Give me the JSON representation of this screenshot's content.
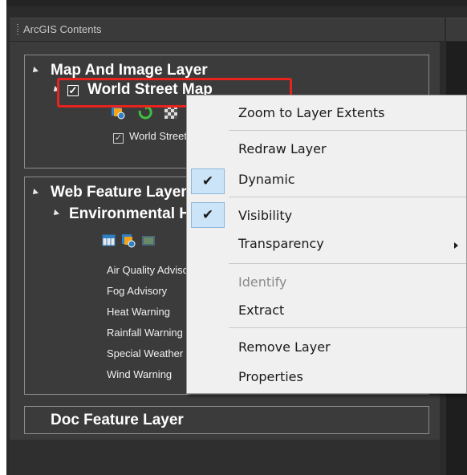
{
  "panel": {
    "title": "ArcGIS Contents"
  },
  "tree": {
    "map_image_layer": {
      "label": "Map And Image Layer",
      "child": {
        "label": "World Street Map",
        "checked": true
      },
      "sublayer": {
        "label": "World Street Map",
        "checked": true
      }
    },
    "web_feature_layer": {
      "label": "Web Feature Layer",
      "child": {
        "label": "Environmental Hazards"
      },
      "sublayers": [
        "Air Quality Advisory",
        "Fog Advisory",
        "Heat Warning",
        "Rainfall Warning",
        "Special Weather Statement",
        "Wind Warning"
      ]
    },
    "doc_feature_layer": {
      "label": "Doc Feature Layer"
    }
  },
  "context_menu": {
    "items": [
      {
        "label": "Zoom to Layer Extents",
        "enabled": true
      },
      {
        "label": "Redraw Layer",
        "enabled": true
      },
      {
        "label": "Dynamic",
        "enabled": true,
        "checked": true
      },
      {
        "label": "Visibility",
        "enabled": true,
        "checked": true
      },
      {
        "label": "Transparency",
        "enabled": true,
        "submenu": true
      },
      {
        "label": "Identify",
        "enabled": false
      },
      {
        "label": "Extract",
        "enabled": true
      },
      {
        "label": "Remove Layer",
        "enabled": true
      },
      {
        "label": "Properties",
        "enabled": true
      }
    ],
    "check_glyph": "✔"
  },
  "colors": {
    "highlight_border": "#e8231d",
    "menu_background": "#f0f0f0",
    "checked_box": "#cce4f7",
    "panel_background": "#3b3b3b"
  }
}
